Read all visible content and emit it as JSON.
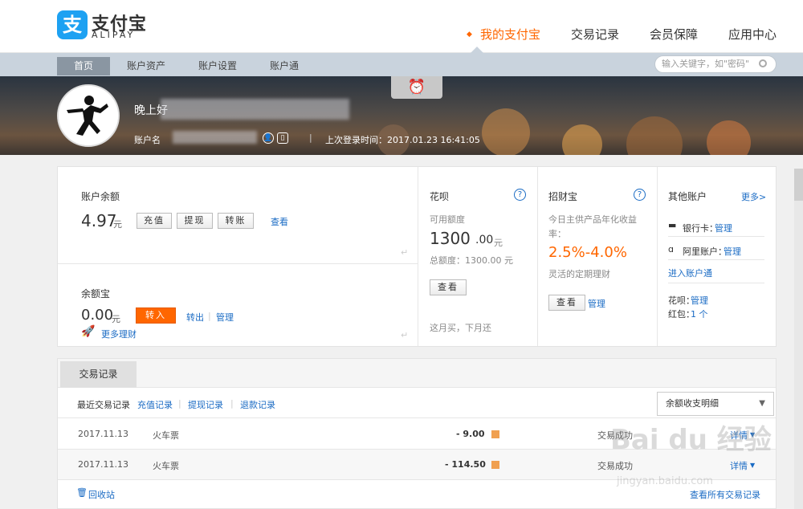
{
  "logo": {
    "mark": "支",
    "cn": "支付宝",
    "en": "ALIPAY"
  },
  "main_nav": [
    {
      "label": "我的支付宝",
      "active": true
    },
    {
      "label": "交易记录"
    },
    {
      "label": "会员保障"
    },
    {
      "label": "应用中心"
    }
  ],
  "sub_nav": [
    {
      "label": "首页",
      "active": true
    },
    {
      "label": "账户资产"
    },
    {
      "label": "账户设置"
    },
    {
      "label": "账户通"
    }
  ],
  "search": {
    "placeholder": "输入关键字，如\"密码\""
  },
  "profile": {
    "greeting": "晚上好",
    "account_label": "账户名",
    "last_login": "上次登录时间：2017.01.23 16:41:05"
  },
  "balance": {
    "title": "账户余额",
    "amount_int": "4.97",
    "unit": "元",
    "recharge": "充值",
    "withdraw": "提现",
    "transfer": "转账",
    "view": "查看"
  },
  "yuebao": {
    "title": "余额宝",
    "amount_int": "0.00",
    "unit": "元",
    "transfer_in": "转入",
    "transfer_out": "转出",
    "manage": "管理",
    "more": "更多理财"
  },
  "huabei": {
    "title": "花呗",
    "available_label": "可用额度",
    "available_int": "1300",
    "available_dec": ".00",
    "unit": "元",
    "total": "总额度：1300.00 元",
    "view": "查看",
    "slogan": "这月买，下月还"
  },
  "zhaocai": {
    "title": "招财宝",
    "desc": "今日主供产品年化收益率：",
    "rate": "2.5%-4.0%",
    "note": "灵活的定期理财",
    "view": "查看",
    "manage": "管理"
  },
  "other": {
    "title": "其他账户",
    "more": "更多>",
    "bank_label": "银行卡：",
    "bank_link": "管理",
    "ali_label": "阿里账户：",
    "ali_link": "管理",
    "enter": "进入账户通",
    "huabei_label": "花呗：",
    "huabei_link": "管理",
    "hongbao_label": "红包：",
    "hongbao_count": "1 个"
  },
  "transactions": {
    "tab": "交易记录",
    "recent": "最近交易记录",
    "filters": [
      "充值记录",
      "提现记录",
      "退款记录"
    ],
    "dropdown": "余额收支明细",
    "rows": [
      {
        "date": "2017.11.13",
        "name": "火车票",
        "amount": "- 9.00",
        "status": "交易成功",
        "detail": "详情"
      },
      {
        "date": "2017.11.13",
        "name": "火车票",
        "amount": "- 114.50",
        "status": "交易成功",
        "detail": "详情"
      }
    ],
    "recycle": "回收站",
    "view_all": "查看所有交易记录"
  },
  "watermark": {
    "logo": "Bai du 经验",
    "url": "jingyan.baidu.com"
  }
}
